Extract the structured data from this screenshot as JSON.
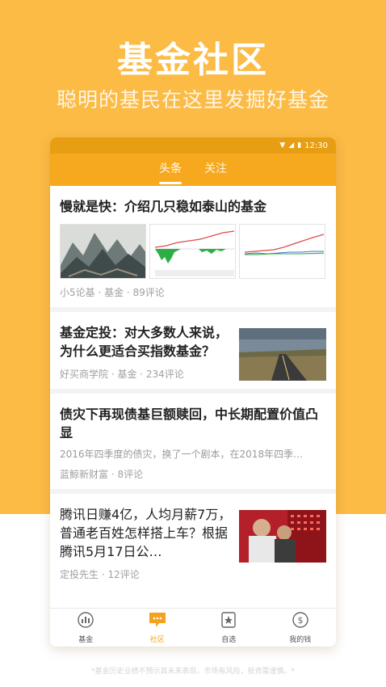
{
  "hero": {
    "title": "基金社区",
    "subtitle": "聪明的基民在这里发掘好基金"
  },
  "status_bar": {
    "time": "12:30"
  },
  "tabs": [
    {
      "label": "头条",
      "active": true
    },
    {
      "label": "关注",
      "active": false
    }
  ],
  "feed": [
    {
      "title": "慢就是快：介绍几只稳如泰山的基金",
      "meta": "小5论基 · 基金 · 89评论"
    },
    {
      "title": "基金定投：对大多数人来说，为什么更适合买指数基金？",
      "meta": "好买商学院 · 基金 · 234评论"
    },
    {
      "title": "债灾下再现债基巨额赎回，中长期配置价值凸显",
      "excerpt": "2016年四季度的债灾，换了一个剧本，在2018年四季…",
      "meta": "蓝鲸新财富 · 8评论"
    },
    {
      "title": "腾讯日赚4亿，人均月薪7万，普通老百姓怎样搭上车？根据腾讯5月17日公…",
      "meta": "定投先生 · 12评论"
    }
  ],
  "bottom_nav": [
    {
      "label": "基金",
      "icon": "chart-icon",
      "active": false
    },
    {
      "label": "社区",
      "icon": "chat-icon",
      "active": true
    },
    {
      "label": "自选",
      "icon": "star-icon",
      "active": false
    },
    {
      "label": "我的钱",
      "icon": "money-icon",
      "active": false
    }
  ],
  "disclaimer": "*基金历史业绩不预示其未来表现，市场有风险，投资需谨慎。*",
  "colors": {
    "accent": "#f6a91f",
    "background_top": "#fbbb45"
  }
}
